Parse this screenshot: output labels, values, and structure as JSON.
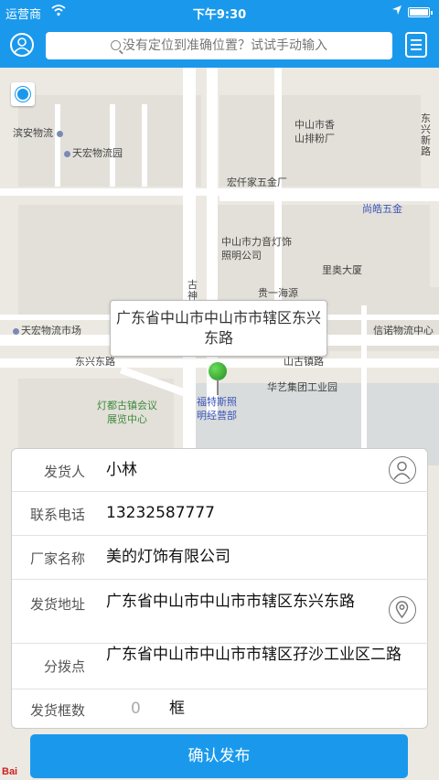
{
  "status_bar": {
    "carrier": "运营商",
    "time": "下午9:30"
  },
  "header": {
    "search_placeholder": "没有定位到准确位置？试试手动输入"
  },
  "map": {
    "labels": {
      "binan": "滨安物流",
      "tianhong": "天宏物流园",
      "xianggang": "中山市香山排粉厂",
      "hongqian": "宏仟家五金厂",
      "shanghao": "尚皓五金",
      "lighting": "中山市力音灯饰照明公司",
      "liaodasha": "里奥大厦",
      "tianhong_market": "天宏物流市场",
      "xinnuo": "信诺物流中心",
      "dongxing": "东兴东路",
      "gudu": "灯都古镇会议展览中心",
      "futesi": "福特斯照明经营部",
      "huayi": "华艺集团工业园",
      "gushen": "古神",
      "dongxingxin": "东兴新路",
      "guiyi": "贵一海源",
      "shan_road": "山古镇路"
    },
    "callout": "广东省中山市中山市市辖区东兴东路"
  },
  "form": {
    "sender_label": "发货人",
    "sender_value": "小林",
    "phone_label": "联系电话",
    "phone_value": "13232587777",
    "factory_label": "厂家名称",
    "factory_value": "美的灯饰有限公司",
    "address_label": "发货地址",
    "address_value": "广东省中山市中山市市辖区东兴东路",
    "distribution_label": "分拨点",
    "distribution_value": "广东省中山市中山市市辖区孖沙工业区二路",
    "count_label": "发货框数",
    "count_value": "0",
    "count_unit": "框"
  },
  "confirm_button": "确认发布",
  "baidu_logo": "Bai"
}
